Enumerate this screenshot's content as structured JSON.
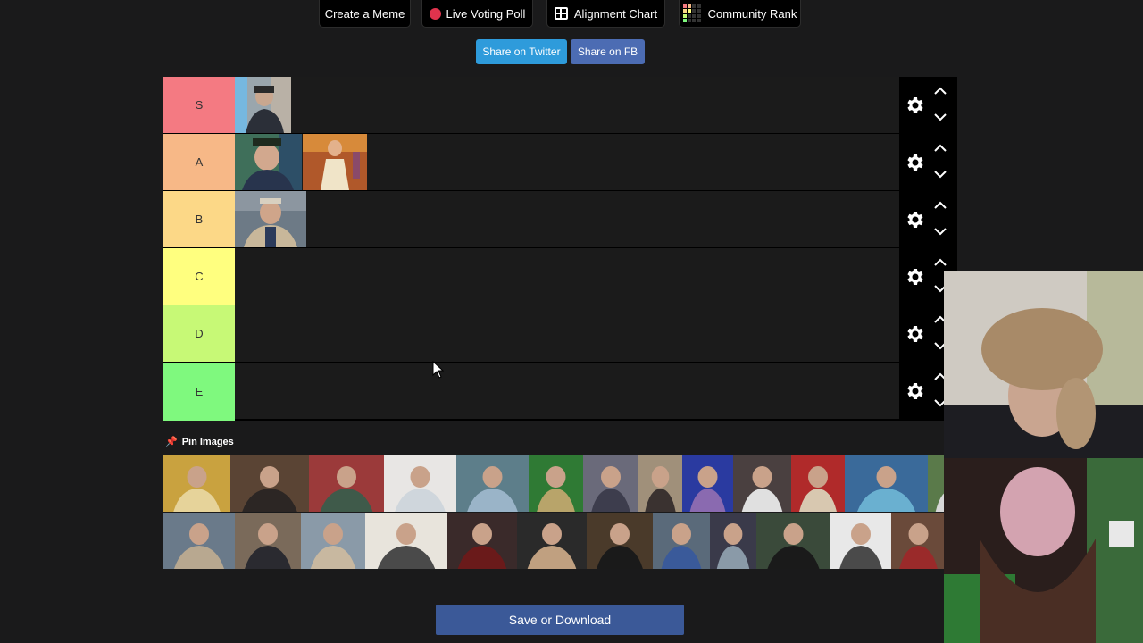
{
  "nav": {
    "create_meme": "Create a Meme",
    "live_voting": "Live Voting Poll",
    "alignment_chart": "Alignment Chart",
    "community_rank": "Community Rank"
  },
  "share": {
    "twitter": "Share on Twitter",
    "facebook": "Share on FB"
  },
  "colors": {
    "twitter": "#2e9bdb",
    "facebook": "#4c6cb3",
    "save": "#3b5998"
  },
  "tiers": [
    {
      "label": "S",
      "color": "#f47a82",
      "items": 1
    },
    {
      "label": "A",
      "color": "#f7b887",
      "items": 2
    },
    {
      "label": "B",
      "color": "#fcd887",
      "items": 1
    },
    {
      "label": "C",
      "color": "#ffff7f",
      "items": 0
    },
    {
      "label": "D",
      "color": "#c7f976",
      "items": 0
    },
    {
      "label": "E",
      "color": "#7ff97e",
      "items": 0
    }
  ],
  "pin_images_label": "Pin Images",
  "pool_count": 28,
  "save_label": "Save or Download"
}
